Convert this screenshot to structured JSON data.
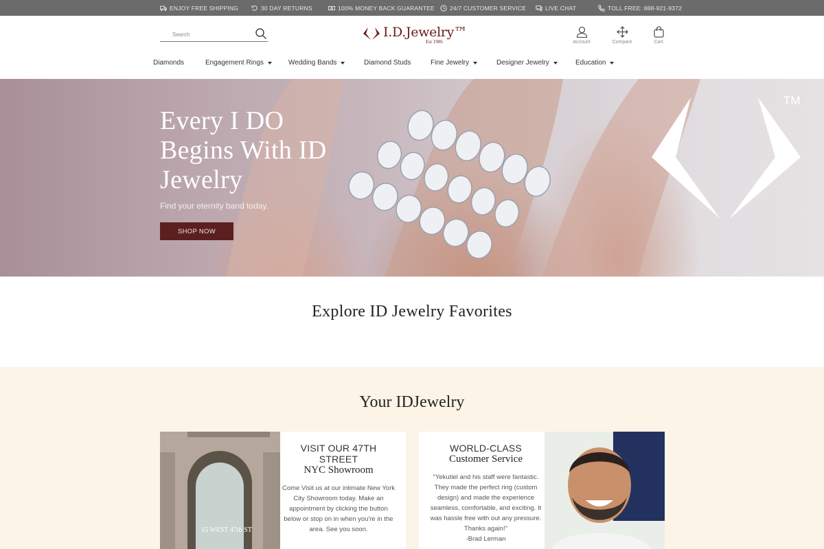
{
  "topbar": {
    "items": [
      {
        "label": "ENJOY FREE SHIPPING",
        "icon": "truck-icon"
      },
      {
        "label": "30 DAY RETURNS",
        "icon": "return-icon"
      },
      {
        "label": "100% MONEY BACK GUARANTEE",
        "icon": "money-icon"
      },
      {
        "label": "24/7 CUSTOMER SERVICE",
        "icon": "clock-icon"
      },
      {
        "label": "LIVE CHAT",
        "icon": "chat-icon"
      },
      {
        "label": "TOLL FREE: 888-921-9372",
        "icon": "phone-icon"
      }
    ]
  },
  "header": {
    "search_placeholder": "Search",
    "logo_name": "I.D.Jewelry™",
    "logo_est": "Est 1986",
    "account_label": "Account",
    "compare_label": "Compare",
    "cart_label": "Cart"
  },
  "nav": {
    "items": [
      {
        "label": "Diamonds",
        "dropdown": false
      },
      {
        "label": "Engagement Rings",
        "dropdown": true
      },
      {
        "label": "Wedding Bands",
        "dropdown": true
      },
      {
        "label": "Diamond Studs",
        "dropdown": false
      },
      {
        "label": "Fine Jewelry",
        "dropdown": true
      },
      {
        "label": "Designer Jewelry",
        "dropdown": true
      },
      {
        "label": "Education",
        "dropdown": true
      }
    ]
  },
  "hero": {
    "title": "Every I DO Begins With ID Jewelry",
    "subtitle": "Find your eternity band today.",
    "cta": "SHOP NOW",
    "tm": "TM"
  },
  "favorites": {
    "title": "Explore ID Jewelry Favorites"
  },
  "your_id": {
    "title": "Your IDJewelry",
    "showroom": {
      "title_line1": "VISIT OUR 47TH STREET",
      "title_line2": "NYC Showroom",
      "body": "Come Visit us at our intimate New York City Showroom today. Make an appointment by clicking the button below or stop on in when you're in the area. See you soon.",
      "photo_sign": "15 WEST 47th ST"
    },
    "service": {
      "title_line1": "WORLD-CLASS",
      "title_line2": "Customer Service",
      "body": "\"Yekutiel and his staff were fantastic. They made the perfect ring (custom design) and made the experience seamless, comfortable, and exciting. It was hassle free with out any pressure. Thanks again!\"",
      "author": "-Brad Lerman"
    }
  },
  "colors": {
    "brand": "#6e1a1a",
    "button": "#5b1f1f",
    "topbar": "#6b6b6b",
    "section_bg": "#fcf4e6"
  }
}
